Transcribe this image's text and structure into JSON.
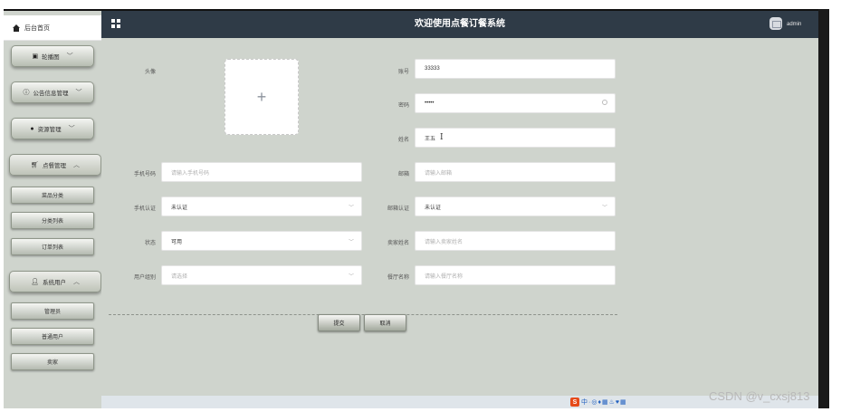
{
  "app": {
    "title": "欢迎使用点餐订餐系统",
    "user": "admin",
    "accent_header": "#2f3b47",
    "background": "#cfd4cd"
  },
  "sidebar": {
    "home_label": "后台首页",
    "menus": [
      {
        "label": "轮播图",
        "icon": "image-icon",
        "expanded": false
      },
      {
        "label": "公告信息管理",
        "icon": "info-icon",
        "expanded": false
      },
      {
        "label": "资源管理",
        "icon": "dot-icon",
        "expanded": false
      },
      {
        "label": "点餐管理",
        "icon": "cart-icon",
        "expanded": true
      },
      {
        "label": "系统用户",
        "icon": "user-icon",
        "expanded": true
      }
    ],
    "order_items": [
      "菜品分类",
      "分类列表",
      "订单列表"
    ],
    "user_items": [
      "管理员",
      "普通用户",
      "卖家"
    ]
  },
  "form": {
    "avatar_label": "头像",
    "avatar_upload_glyph": "+",
    "account_label": "账号",
    "account_value": "33333",
    "password_label": "密码",
    "password_value": "•••••",
    "name_label": "姓名",
    "name_value": "王五",
    "phone_label": "手机号码",
    "phone_placeholder": "请输入手机号码",
    "email_label": "邮箱",
    "email_placeholder": "请输入邮箱",
    "phone_verify_label": "手机认证",
    "phone_verify_value": "未认证",
    "email_verify_label": "邮箱认证",
    "email_verify_value": "未认证",
    "status_label": "状态",
    "status_value": "可用",
    "seller_name_label": "卖家姓名",
    "seller_name_placeholder": "请输入卖家姓名",
    "user_group_label": "用户组别",
    "user_group_placeholder": "请选择",
    "restaurant_label": "餐厅名称",
    "restaurant_placeholder": "请输入餐厅名称",
    "submit_label": "提交",
    "cancel_label": "取消"
  },
  "taskbar": {
    "ime_logo": "S",
    "ime_text": "中·◎♦▦♨♥▦"
  },
  "watermark": "CSDN @v_cxsj813"
}
